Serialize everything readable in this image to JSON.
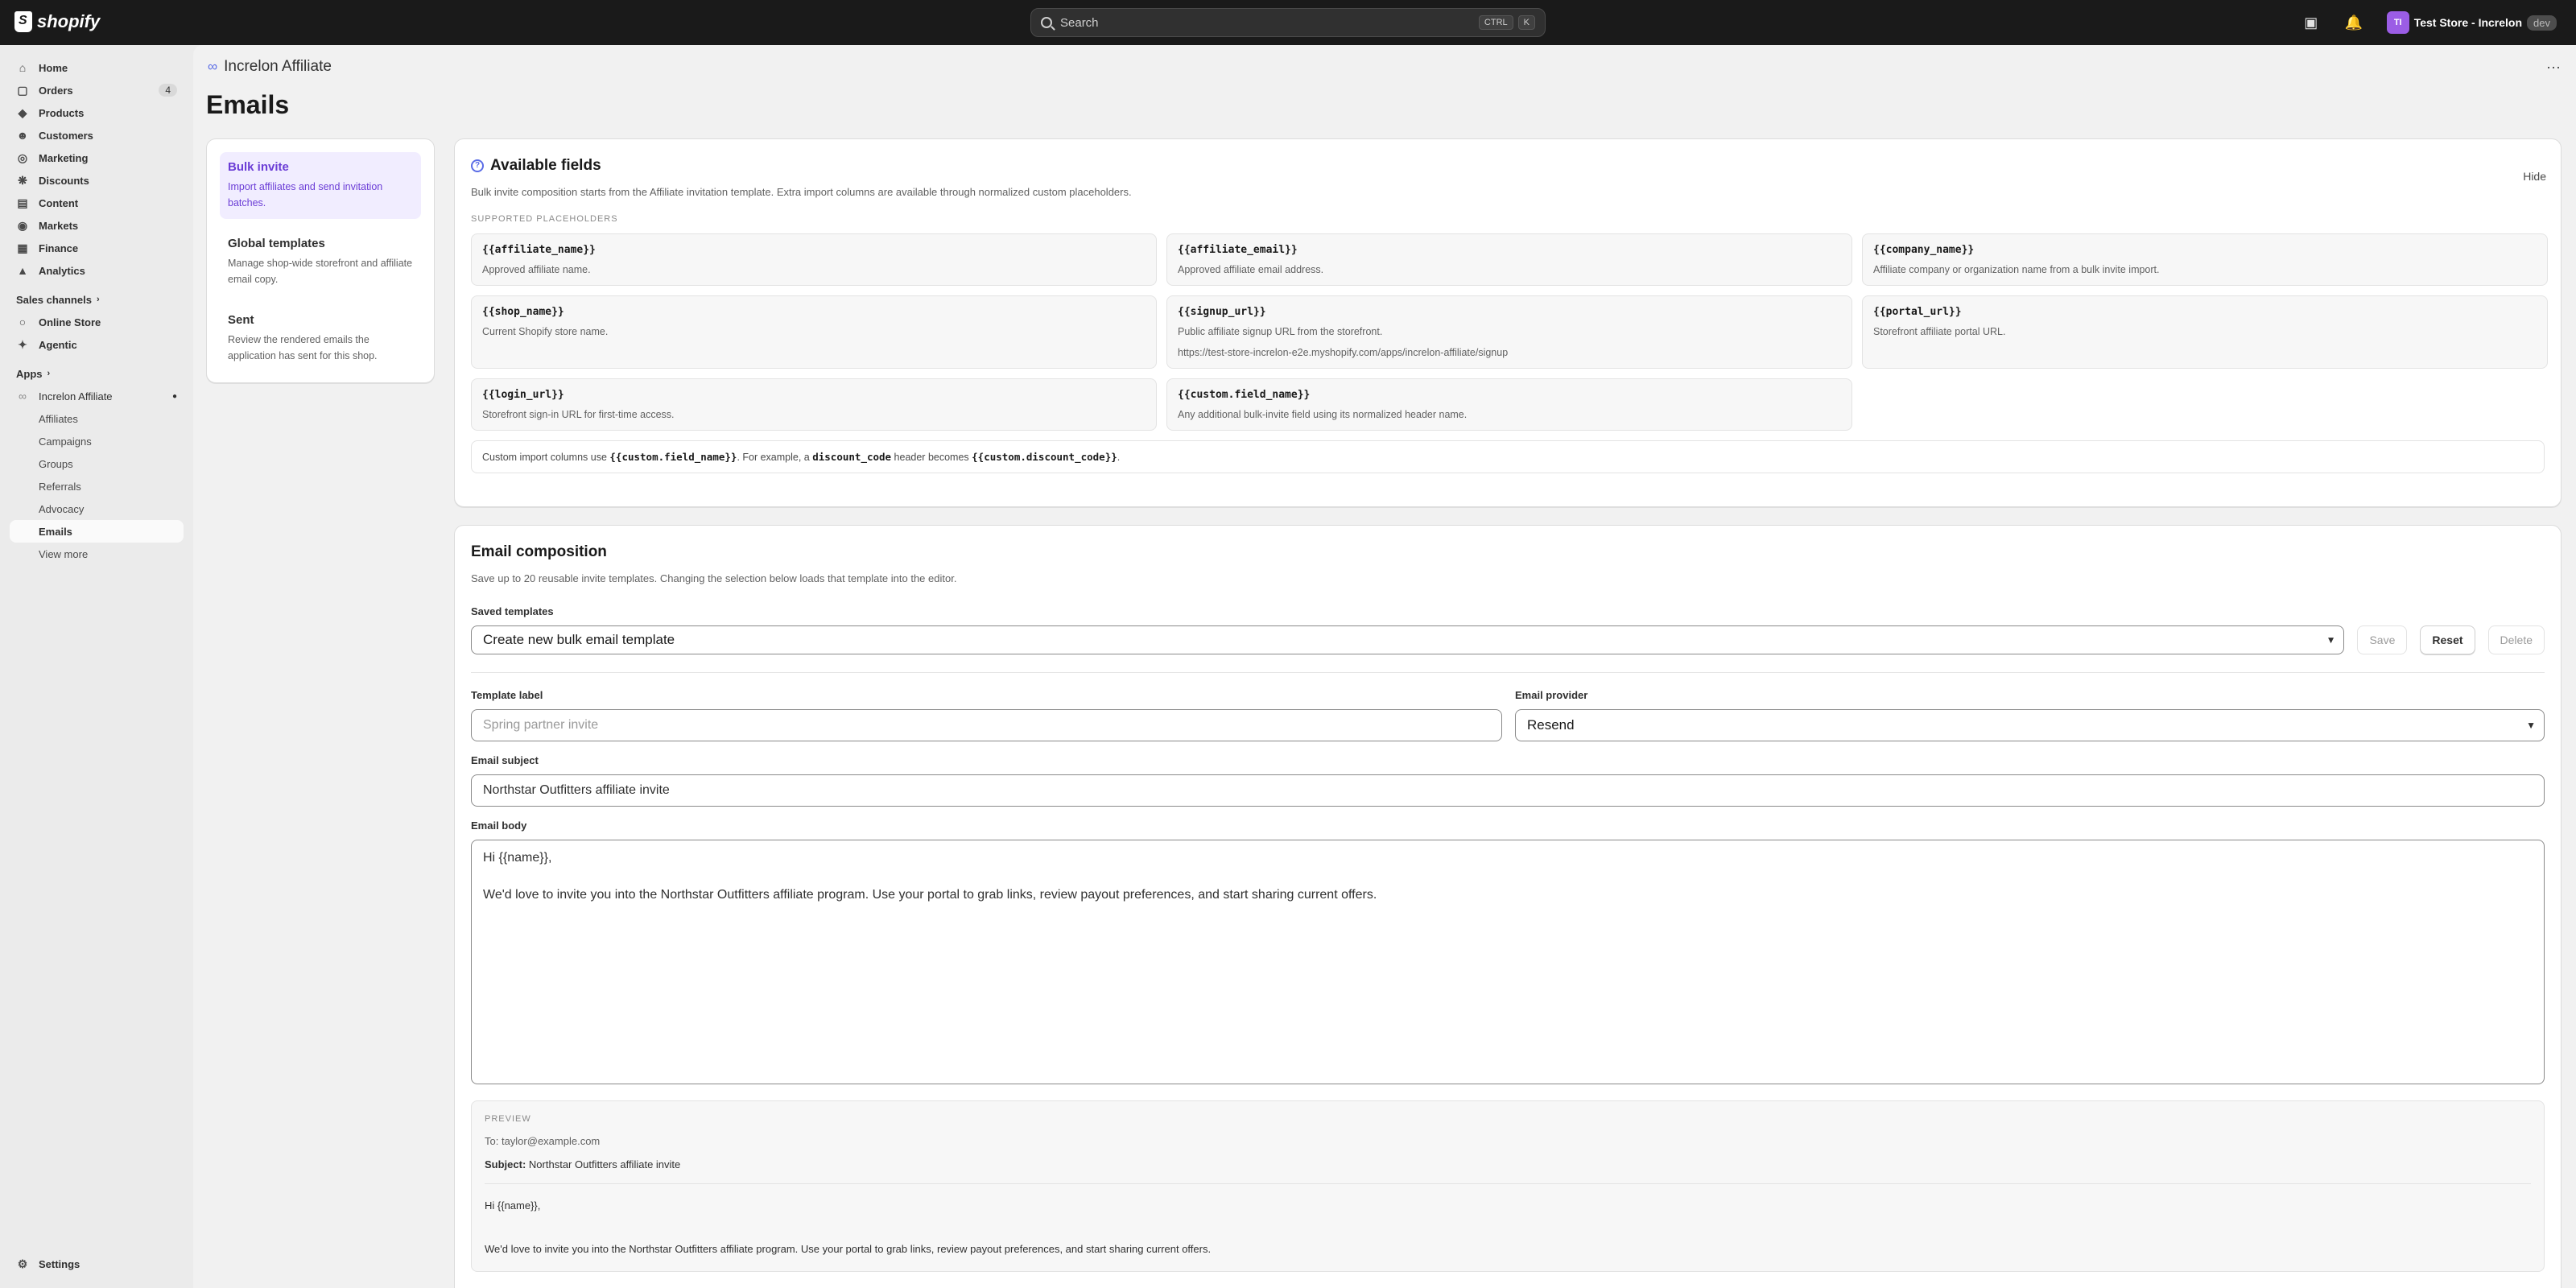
{
  "topbar": {
    "logo": "shopify",
    "search_placeholder": "Search",
    "kbd_ctrl": "CTRL",
    "kbd_k": "K",
    "store_initials": "TI",
    "store_name": "Test Store - Increlon",
    "dev_badge": "dev"
  },
  "sidebar": {
    "items": [
      {
        "label": "Home",
        "icon": "home-icon"
      },
      {
        "label": "Orders",
        "icon": "orders-icon",
        "count": "4"
      },
      {
        "label": "Products",
        "icon": "products-icon"
      },
      {
        "label": "Customers",
        "icon": "customers-icon"
      },
      {
        "label": "Marketing",
        "icon": "marketing-icon"
      },
      {
        "label": "Discounts",
        "icon": "discounts-icon"
      },
      {
        "label": "Content",
        "icon": "content-icon"
      },
      {
        "label": "Markets",
        "icon": "markets-icon"
      },
      {
        "label": "Finance",
        "icon": "finance-icon"
      },
      {
        "label": "Analytics",
        "icon": "analytics-icon"
      }
    ],
    "sales_channels_label": "Sales channels",
    "channels": [
      {
        "label": "Online Store"
      },
      {
        "label": "Agentic"
      }
    ],
    "apps_label": "Apps",
    "app_name": "Increlon Affiliate",
    "app_subitems": [
      "Affiliates",
      "Campaigns",
      "Groups",
      "Referrals",
      "Advocacy",
      "Emails",
      "View more"
    ],
    "settings_label": "Settings"
  },
  "header": {
    "app_title": "Increlon Affiliate",
    "page_title": "Emails"
  },
  "tabs": [
    {
      "title": "Bulk invite",
      "desc": "Import affiliates and send invitation batches."
    },
    {
      "title": "Global templates",
      "desc": "Manage shop-wide storefront and affiliate email copy."
    },
    {
      "title": "Sent",
      "desc": "Review the rendered emails the application has sent for this shop."
    }
  ],
  "fields": {
    "title": "Available fields",
    "subtitle": "Bulk invite composition starts from the Affiliate invitation template. Extra import columns are available through normalized custom placeholders.",
    "hide_label": "Hide",
    "section_label": "SUPPORTED PLACEHOLDERS",
    "placeholders": [
      {
        "code": "{{affiliate_name}}",
        "desc": "Approved affiliate name."
      },
      {
        "code": "{{affiliate_email}}",
        "desc": "Approved affiliate email address."
      },
      {
        "code": "{{company_name}}",
        "desc": "Affiliate company or organization name from a bulk invite import."
      },
      {
        "code": "{{shop_name}}",
        "desc": "Current Shopify store name."
      },
      {
        "code": "{{signup_url}}",
        "desc": "Public affiliate signup URL from the storefront.",
        "url": "https://test-store-increlon-e2e.myshopify.com/apps/increlon-affiliate/signup"
      },
      {
        "code": "{{portal_url}}",
        "desc": "Storefront affiliate portal URL."
      },
      {
        "code": "{{login_url}}",
        "desc": "Storefront sign-in URL for first-time access."
      },
      {
        "code": "{{custom.field_name}}",
        "desc": "Any additional bulk-invite field using its normalized header name."
      }
    ],
    "custom_note": {
      "p1": "Custom import columns use ",
      "c1": "{{custom.field_name}}",
      "p2": ". For example, a ",
      "c2": "discount_code",
      "p3": " header becomes ",
      "c3": "{{custom.discount_code}}",
      "p4": "."
    }
  },
  "composition": {
    "title": "Email composition",
    "subtitle": "Save up to 20 reusable invite templates. Changing the selection below loads that template into the editor.",
    "saved_templates_label": "Saved templates",
    "saved_templates_value": "Create new bulk email template",
    "save_label": "Save",
    "reset_label": "Reset",
    "delete_label": "Delete",
    "template_label_label": "Template label",
    "template_label_placeholder": "Spring partner invite",
    "provider_label": "Email provider",
    "provider_value": "Resend",
    "subject_label": "Email subject",
    "subject_value": "Northstar Outfitters affiliate invite",
    "body_label": "Email body",
    "body_line1": "Hi {{name}},",
    "body_line2": "We'd love to invite you into the Northstar Outfitters affiliate program. Use your portal to grab links, review payout preferences, and start sharing current offers.",
    "preview": {
      "label": "PREVIEW",
      "to": "To: taylor@example.com",
      "subject_key": "Subject:",
      "subject_value": "Northstar Outfitters affiliate invite",
      "line1": "Hi {{name}},",
      "line2": "We'd love to invite you into the Northstar Outfitters affiliate program. Use your portal to grab links, review payout preferences, and start sharing current offers."
    }
  },
  "colors": {
    "accent": "#6b3dd6",
    "topbar": "#1a1a1a",
    "active_tab_bg": "#f1edff"
  }
}
